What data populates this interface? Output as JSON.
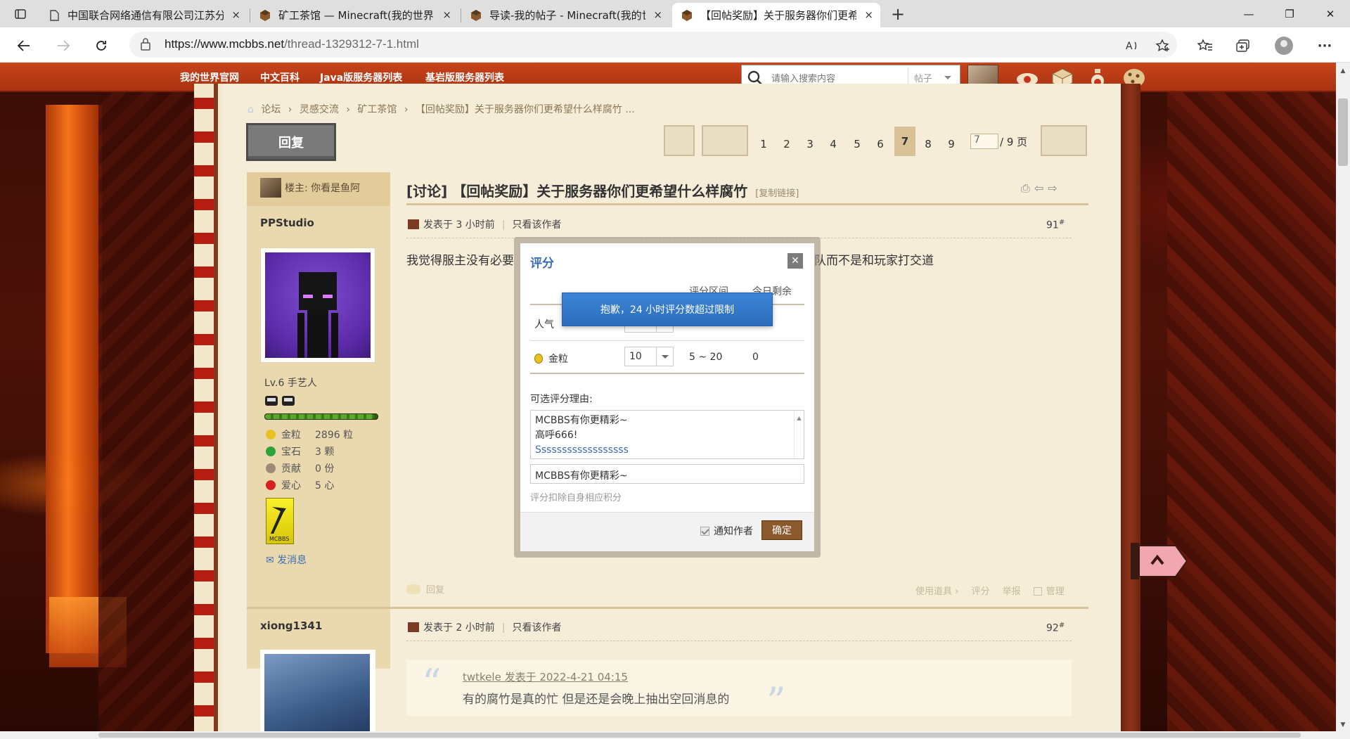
{
  "browser": {
    "tabs": [
      {
        "label": "中国联合网络通信有限公司江苏分",
        "close": "×"
      },
      {
        "label": "矿工茶馆 — Minecraft(我的世界)",
        "close": "×"
      },
      {
        "label": "导读-我的帖子 - Minecraft(我的世",
        "close": "×"
      },
      {
        "label": "【回帖奖励】关于服务器你们更希",
        "close": "×"
      }
    ],
    "new_tab": "+",
    "window_controls": {
      "minimize": "—",
      "restore": "❐",
      "close": "✕"
    },
    "url_host": "https://www.mcbbs.net",
    "url_path": "/thread-1329312-7-1.html",
    "more_menu": "···"
  },
  "site": {
    "nav_links": [
      "我的世界官网",
      "中文百科",
      "Java版服务器列表",
      "基岩版服务器列表"
    ],
    "search_placeholder": "请输入搜索内容",
    "search_type": "帖子"
  },
  "breadcrumb": [
    "论坛",
    "›",
    "灵感交流",
    "›",
    "矿工茶馆",
    "›",
    "【回帖奖励】关于服务器你们更希望什么样腐竹 ..."
  ],
  "reply_button": "回复",
  "pager": {
    "pages": [
      "1",
      "2",
      "3",
      "4",
      "5",
      "6",
      "7",
      "8",
      "9"
    ],
    "current": "7",
    "jump_value": "7",
    "total": "/ 9 页"
  },
  "thread": {
    "op_label": "楼主: 你看是鱼阿",
    "title": "[讨论] 【回帖奖励】关于服务器你们更希望什么样腐竹",
    "copy_link": "[复制链接]"
  },
  "post1": {
    "author": "PPStudio",
    "posted": "发表于 3 小时前",
    "only_author": "只看该作者",
    "floor": "91",
    "floor_sup": "#",
    "level": "Lv.6 手艺人",
    "level_progress": 0.97,
    "stats": [
      {
        "label": "金粒",
        "value": "2896 粒",
        "color": "#e8c21e"
      },
      {
        "label": "宝石",
        "value": "3 颗",
        "color": "#2fa33a"
      },
      {
        "label": "贡献",
        "value": "0 份",
        "color": "#a08878"
      },
      {
        "label": "爱心",
        "value": "5 心",
        "color": "#d82020"
      }
    ],
    "send_message": "发消息",
    "body_left": "我觉得服主没有必要",
    "body_right": "队而不是和玩家打交道",
    "footer_reply": "回复",
    "footer_actions": [
      "使用道具 ›",
      "评分",
      "举报",
      "管理"
    ]
  },
  "post2": {
    "author": "xiong1341",
    "posted": "发表于 2 小时前",
    "only_author": "只看该作者",
    "floor": "92",
    "floor_sup": "#",
    "quote_author": "twtkele 发表于 2022-4-21 04:15",
    "quote_text": "有的腐竹是真的忙 但是还是会晚上抽出空回消息的"
  },
  "dialog": {
    "title": "评分",
    "close": "✕",
    "col_range": "评分区间",
    "col_remaining": "今日剩余",
    "rows": [
      {
        "label": "人气",
        "value": "",
        "range": "",
        "remaining": ""
      },
      {
        "label": "金粒",
        "value": "10",
        "range": "5 ~ 20",
        "remaining": "0"
      }
    ],
    "toast": "抱歉，24 小时评分数超过限制",
    "reason_label": "可选评分理由:",
    "reasons": [
      "MCBBS有你更精彩~",
      "高呼666!",
      "Ssssssssssssssssss"
    ],
    "reason_input": "MCBBS有你更精彩~",
    "deduct_note": "评分扣除自身相应积分",
    "notify": "通知作者",
    "confirm": "确定"
  }
}
